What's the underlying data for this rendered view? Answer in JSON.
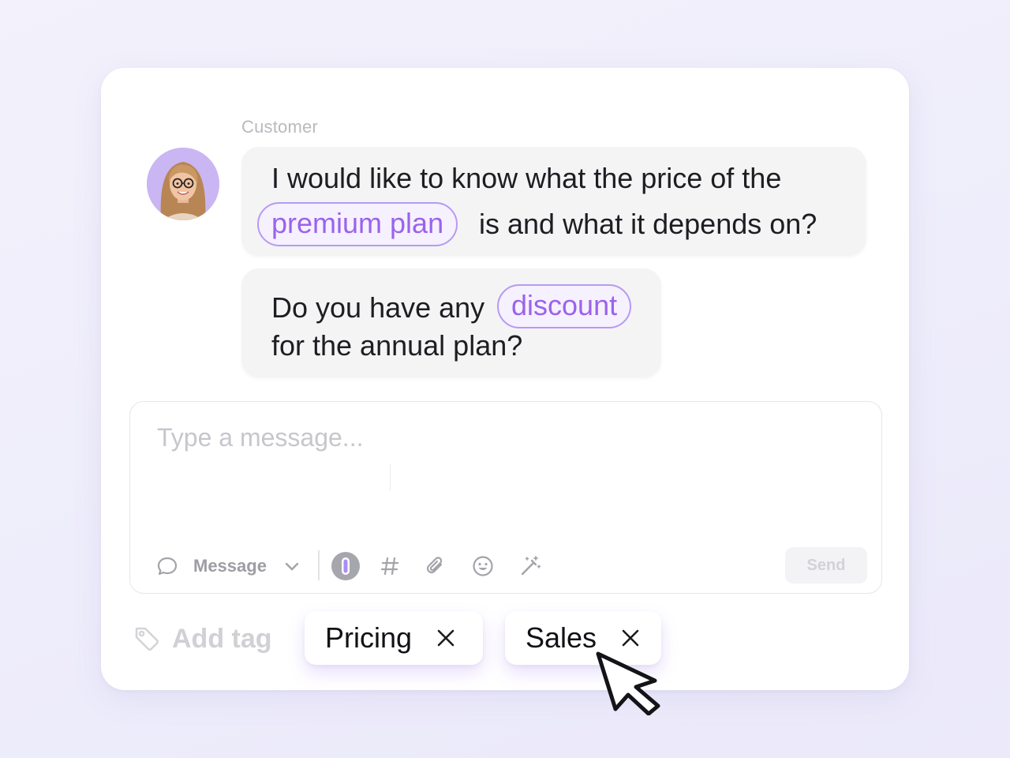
{
  "conversation": {
    "sender_label": "Customer",
    "messages": [
      {
        "line1": "I would like to know what the price of the",
        "chip": "premium plan",
        "line2_rest": "is and what it depends on?"
      },
      {
        "line1_lead": "Do you have any",
        "chip": "discount",
        "line2": "for the annual plan?"
      }
    ]
  },
  "composer": {
    "placeholder": "Type a message...",
    "mode_label": "Message",
    "send_label": "Send",
    "toolbar_icons": [
      "message-bubble-icon",
      "chevron-down-icon",
      "ai-assistant-icon",
      "hashtag-icon",
      "paperclip-icon",
      "emoji-icon",
      "magic-wand-icon"
    ]
  },
  "tags": {
    "add_label": "Add tag",
    "items": [
      {
        "label": "Pricing"
      },
      {
        "label": "Sales"
      }
    ]
  },
  "colors": {
    "accent": "#9a63ec",
    "chip_border": "#b79af3",
    "avatar_bg": "#c9b6f3"
  }
}
